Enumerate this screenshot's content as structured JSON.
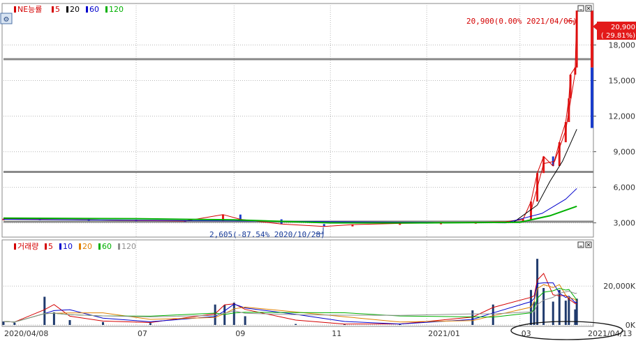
{
  "chart_data": [
    {
      "type": "line",
      "panel": "price",
      "legend": [
        {
          "label": "NE능률",
          "color": "#d40000"
        },
        {
          "label": "5",
          "color": "#d40000"
        },
        {
          "label": "20",
          "color": "#000000"
        },
        {
          "label": "60",
          "color": "#0000cc"
        },
        {
          "label": "120",
          "color": "#00b000"
        }
      ],
      "yticks": [
        "3,000",
        "6,000",
        "9,000",
        "12,000",
        "15,000",
        "18,000"
      ],
      "ylim": [
        1800,
        21500
      ],
      "xticks": [
        "2020/04/08",
        "07",
        "09",
        "11",
        "2021/01",
        "03",
        "2021/04/13"
      ],
      "x_range": [
        "2020-04-08",
        "2021-04-13"
      ],
      "hlines": [
        16800,
        7300,
        3100
      ],
      "annotations": {
        "high": "20,900(0.00% 2021/04/06)",
        "low": "2,605(-87.54% 2020/10/28)"
      },
      "current_price": {
        "value": "20,900",
        "change": "( 29.81%)"
      },
      "series": [
        {
          "name": "NE능률",
          "color": "#d40000",
          "points": [
            [
              "2020-04-08",
              3350
            ],
            [
              "2020-05-01",
              3300
            ],
            [
              "2020-06-01",
              3250
            ],
            [
              "2020-07-01",
              3200
            ],
            [
              "2020-08-01",
              3150
            ],
            [
              "2020-08-25",
              3700
            ],
            [
              "2020-09-05",
              3300
            ],
            [
              "2020-10-01",
              2900
            ],
            [
              "2020-10-28",
              2700
            ],
            [
              "2020-11-15",
              2850
            ],
            [
              "2020-12-15",
              2950
            ],
            [
              "2021-01-10",
              3000
            ],
            [
              "2021-02-01",
              3050
            ],
            [
              "2021-02-20",
              3100
            ],
            [
              "2021-03-03",
              3300
            ],
            [
              "2021-03-08",
              4800
            ],
            [
              "2021-03-12",
              7200
            ],
            [
              "2021-03-16",
              8600
            ],
            [
              "2021-03-22",
              7800
            ],
            [
              "2021-03-26",
              9800
            ],
            [
              "2021-03-30",
              11500
            ],
            [
              "2021-04-01",
              13500
            ],
            [
              "2021-04-02",
              15500
            ],
            [
              "2021-04-05",
              16100
            ],
            [
              "2021-04-06",
              20900
            ]
          ]
        },
        {
          "name": "5",
          "color": "#d40000",
          "points": [
            [
              "2021-03-08",
              4000
            ],
            [
              "2021-03-16",
              8000
            ],
            [
              "2021-03-23",
              8200
            ],
            [
              "2021-03-30",
              10800
            ],
            [
              "2021-04-06",
              16500
            ]
          ]
        },
        {
          "name": "20",
          "color": "#000000",
          "points": [
            [
              "2021-02-25",
              3050
            ],
            [
              "2021-03-12",
              4500
            ],
            [
              "2021-03-20",
              6500
            ],
            [
              "2021-03-28",
              8200
            ],
            [
              "2021-04-06",
              10900
            ]
          ]
        },
        {
          "name": "60",
          "color": "#0000cc",
          "points": [
            [
              "2020-04-08",
              3300
            ],
            [
              "2021-02-20",
              3000
            ],
            [
              "2021-03-15",
              3800
            ],
            [
              "2021-03-30",
              5000
            ],
            [
              "2021-04-06",
              5900
            ]
          ]
        },
        {
          "name": "120",
          "color": "#00b000",
          "points": [
            [
              "2020-04-08",
              3400
            ],
            [
              "2020-07-01",
              3350
            ],
            [
              "2020-09-01",
              3250
            ],
            [
              "2020-11-01",
              3000
            ],
            [
              "2021-01-01",
              3000
            ],
            [
              "2021-03-01",
              3050
            ],
            [
              "2021-03-20",
              3600
            ],
            [
              "2021-04-06",
              4400
            ]
          ]
        }
      ]
    },
    {
      "type": "bar",
      "panel": "volume",
      "legend": [
        {
          "label": "거래량",
          "color": "#d40000"
        },
        {
          "label": "5",
          "color": "#d40000"
        },
        {
          "label": "10",
          "color": "#0000cc"
        },
        {
          "label": "20",
          "color": "#e08000"
        },
        {
          "label": "60",
          "color": "#00b000"
        },
        {
          "label": "120",
          "color": "#909090"
        }
      ],
      "yticks": [
        "0K",
        "20,000K"
      ],
      "ylim": [
        0,
        38000
      ],
      "series": [
        {
          "name": "거래량",
          "color": "#1f3a6d",
          "points": [
            [
              "2020-04-08",
              1800
            ],
            [
              "2020-04-15",
              1200
            ],
            [
              "2020-05-04",
              14500
            ],
            [
              "2020-05-10",
              6500
            ],
            [
              "2020-05-20",
              2500
            ],
            [
              "2020-06-10",
              1500
            ],
            [
              "2020-07-10",
              1000
            ],
            [
              "2020-08-20",
              10500
            ],
            [
              "2020-08-26",
              10200
            ],
            [
              "2020-09-01",
              11500
            ],
            [
              "2020-09-08",
              4500
            ],
            [
              "2020-10-10",
              500
            ],
            [
              "2020-11-10",
              400
            ],
            [
              "2020-12-15",
              600
            ],
            [
              "2021-01-30",
              7500
            ],
            [
              "2021-02-12",
              10500
            ],
            [
              "2021-03-08",
              18000
            ],
            [
              "2021-03-10",
              12000
            ],
            [
              "2021-03-12",
              34000
            ],
            [
              "2021-03-16",
              19000
            ],
            [
              "2021-03-22",
              12000
            ],
            [
              "2021-03-26",
              18000
            ],
            [
              "2021-03-30",
              12500
            ],
            [
              "2021-04-01",
              14000
            ],
            [
              "2021-04-05",
              8000
            ],
            [
              "2021-04-06",
              13500
            ]
          ]
        }
      ]
    }
  ]
}
